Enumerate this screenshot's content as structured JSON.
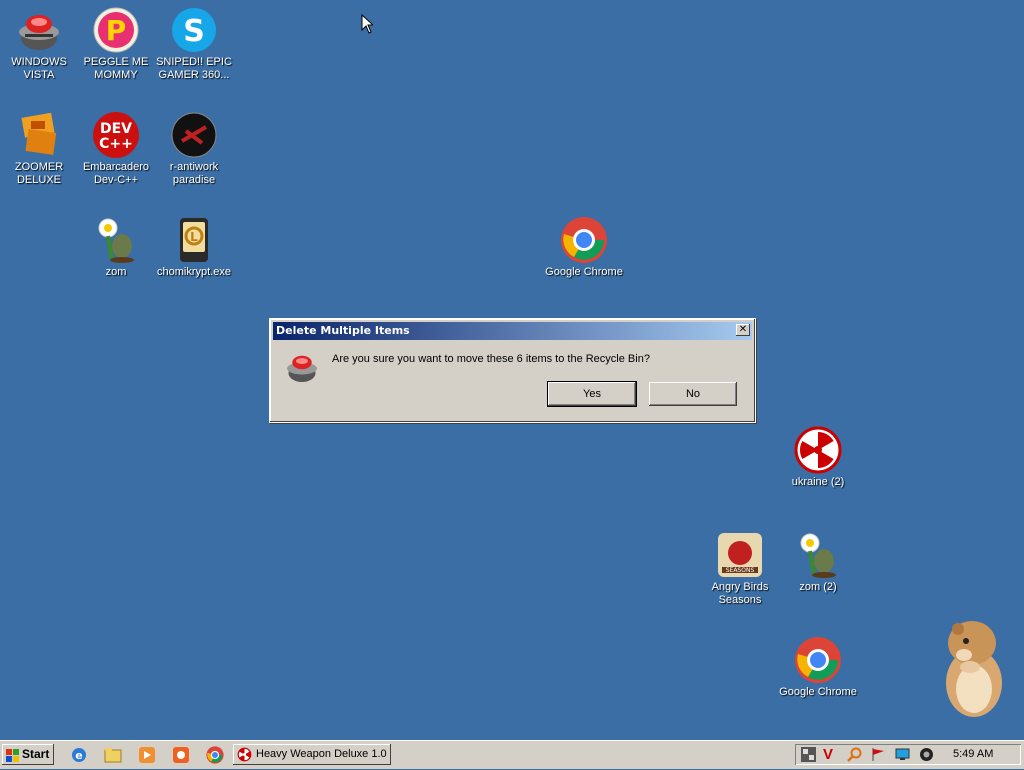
{
  "desktop": {
    "icons": [
      {
        "id": "windows-vista",
        "label": "WINDOWS VISTA"
      },
      {
        "id": "peggle",
        "label": "PEGGLE ME MOMMY"
      },
      {
        "id": "skype",
        "label": "SNIPED!! EPIC GAMER 360..."
      },
      {
        "id": "zoomer",
        "label": "ZOOMER DELUXE"
      },
      {
        "id": "devcpp",
        "label": "Embarcadero Dev-C++"
      },
      {
        "id": "antiwork",
        "label": "r-antiwork paradise"
      },
      {
        "id": "zom",
        "label": "zom"
      },
      {
        "id": "chomikrypt",
        "label": "chomikrypt.exe"
      },
      {
        "id": "chrome1",
        "label": "Google Chrome"
      },
      {
        "id": "ukraine",
        "label": "ukraine (2)"
      },
      {
        "id": "angry-birds",
        "label": "Angry Birds Seasons"
      },
      {
        "id": "zom2",
        "label": "zom (2)"
      },
      {
        "id": "chrome2",
        "label": "Google Chrome"
      }
    ]
  },
  "dialog": {
    "title": "Delete Multiple Items",
    "close": "✕",
    "message": "Are you sure you want to move these 6 items to the Recycle Bin?",
    "yes": "Yes",
    "no": "No"
  },
  "taskbar": {
    "start": "Start",
    "active_window": "Heavy Weapon Deluxe 1.0",
    "clock": "5:49 AM"
  },
  "colors": {
    "desktop": "#3a6ea5",
    "titlebar_start": "#0a246a",
    "titlebar_end": "#a6caf0",
    "chrome": "#ffffff"
  }
}
